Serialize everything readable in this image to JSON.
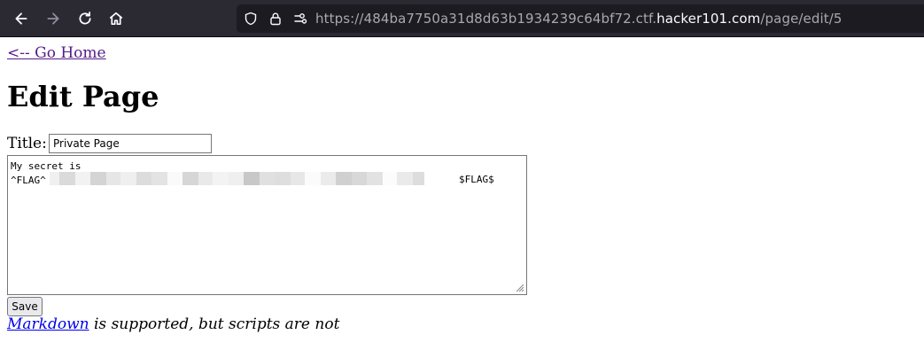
{
  "browser": {
    "url_prefix": "https://484ba7750a31d8d63b1934239c64bf72.ctf.",
    "url_host": "hacker101.com",
    "url_path": "/page/edit/5",
    "icons": [
      "back-arrow-icon",
      "forward-arrow-icon",
      "reload-icon",
      "home-icon",
      "shield-icon",
      "lock-icon",
      "permissions-icon"
    ]
  },
  "page": {
    "home_link": "<-- Go Home",
    "title": "Edit Page",
    "title_label": "Title:",
    "title_value": "Private Page",
    "body_line1": "My secret is",
    "body_flag_prefix": "^FLAG^",
    "body_flag_suffix": "$FLAG$",
    "save_label": "Save",
    "note_link": "Markdown",
    "note_text": " is supported, but scripts are not"
  },
  "colors": {
    "toolbar_bg": "#2b2a33",
    "urlbar_bg": "#1c1b22",
    "visited_link": "#551a8b",
    "link": "#0000ee"
  }
}
